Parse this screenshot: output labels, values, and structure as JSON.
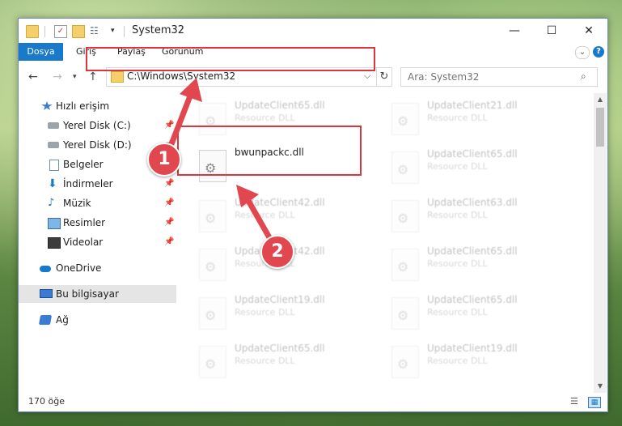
{
  "window": {
    "title": "System32",
    "controls": {
      "minimize": "—",
      "maximize": "☐",
      "close": "✕"
    }
  },
  "quick_access_toolbar": {
    "dropdown": "▾",
    "icons": [
      "folder-icon",
      "properties-check-icon",
      "new-folder-icon",
      "customize-icon"
    ]
  },
  "ribbon": {
    "tabs": [
      "Dosya",
      "Giriş",
      "Paylaş",
      "Görünüm"
    ],
    "accent": "#1979ca",
    "help": "?"
  },
  "navigation": {
    "back": "←",
    "forward": "→",
    "recent": "▾",
    "up": "↑",
    "address": "C:\\Windows\\System32",
    "address_dropdown": "⌵",
    "refresh": "↻",
    "search_placeholder": "Ara: System32"
  },
  "sidebar": {
    "items": [
      {
        "label": "Hızlı erişim",
        "icon": "star-icon",
        "pinned": false
      },
      {
        "label": "Yerel Disk (C:)",
        "icon": "disk-icon",
        "pinned": true
      },
      {
        "label": "Yerel Disk (D:)",
        "icon": "disk-icon",
        "pinned": true
      },
      {
        "label": "Belgeler",
        "icon": "document-icon",
        "pinned": true
      },
      {
        "label": "İndirmeler",
        "icon": "download-icon",
        "pinned": true
      },
      {
        "label": "Müzik",
        "icon": "music-icon",
        "pinned": true
      },
      {
        "label": "Resimler",
        "icon": "pictures-icon",
        "pinned": true
      },
      {
        "label": "Videolar",
        "icon": "videos-icon",
        "pinned": true
      },
      {
        "label": "OneDrive",
        "icon": "cloud-icon",
        "pinned": false
      },
      {
        "label": "Bu bilgisayar",
        "icon": "computer-icon",
        "pinned": false,
        "selected": true
      },
      {
        "label": "Ağ",
        "icon": "network-icon",
        "pinned": false
      }
    ]
  },
  "files": {
    "highlighted": {
      "name": "bwunpackc.dll",
      "type": ""
    },
    "left_column": [
      {
        "name": "UpdateClient65.dll",
        "type": "Resource DLL"
      },
      {
        "name": "UpdateClient42.dll",
        "type": "Resource DLL"
      },
      {
        "name": "UpdateClient42.dll",
        "type": "Resource DLL"
      },
      {
        "name": "UpdateClient19.dll",
        "type": "Resource DLL"
      },
      {
        "name": "UpdateClient65.dll",
        "type": "Resource DLL"
      }
    ],
    "right_column": [
      {
        "name": "UpdateClient21.dll",
        "type": "Resource DLL"
      },
      {
        "name": "UpdateClient65.dll",
        "type": "Resource DLL"
      },
      {
        "name": "UpdateClient63.dll",
        "type": "Resource DLL"
      },
      {
        "name": "UpdateClient65.dll",
        "type": "Resource DLL"
      },
      {
        "name": "UpdateClient65.dll",
        "type": "Resource DLL"
      },
      {
        "name": "UpdateClient19.dll",
        "type": "Resource DLL"
      }
    ]
  },
  "status": {
    "item_count": "170 öğe"
  },
  "annotations": {
    "step_1": "1",
    "step_2": "2",
    "color": "#e0474f"
  }
}
